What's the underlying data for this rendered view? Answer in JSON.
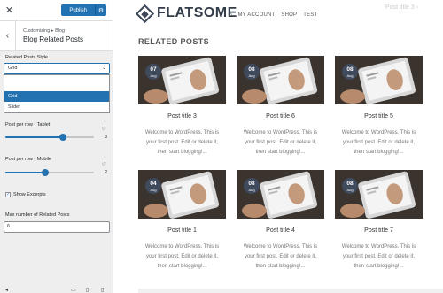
{
  "customizer": {
    "close_icon": "close-icon",
    "publish_label": "Publish",
    "publish_gear_icon": "gear-icon",
    "back_icon": "chevron-left-icon",
    "breadcrumb": "Customizing ▸ Blog",
    "section_title": "Blog Related Posts",
    "related_style": {
      "label": "Related Posts Style",
      "value": "Grid",
      "options": [
        "Grid",
        "Slider"
      ],
      "highlighted": "Grid"
    },
    "per_row_tablet": {
      "label": "Post per row - Tablet",
      "value": "3",
      "fraction": 0.65
    },
    "per_row_mobile": {
      "label": "Post per row - Mobile",
      "value": "2",
      "fraction": 0.45
    },
    "show_excerpts": {
      "label": "Show Excerpts",
      "checked": true,
      "check_mark": "✓"
    },
    "max_related": {
      "label": "Max number of Related Posts",
      "value": "6"
    }
  },
  "site": {
    "logo_text": "FLATSOME",
    "nav": {
      "search_icon": "search-icon",
      "links": [
        "MY ACCOUNT",
        "SHOP",
        "TEST"
      ]
    },
    "header_faded": "Post title 3 ›",
    "related_heading": "RELATED POSTS",
    "excerpt_lines": [
      "Welcome to WordPress. This is",
      "your first post. Edit or delete it,",
      "then start blogging!..."
    ],
    "posts": [
      {
        "day": "07",
        "month": "Aug",
        "title": "Post title 3"
      },
      {
        "day": "08",
        "month": "Aug",
        "title": "Post title 6"
      },
      {
        "day": "08",
        "month": "Aug",
        "title": "Post title 5"
      },
      {
        "day": "04",
        "month": "Aug",
        "title": "Post title 1"
      },
      {
        "day": "08",
        "month": "Aug",
        "title": "Post title 4"
      },
      {
        "day": "08",
        "month": "Aug",
        "title": "Post title 7"
      }
    ]
  },
  "colors": {
    "accent": "#2271b1",
    "badge": "#3f4a5c",
    "heading": "#555555"
  }
}
